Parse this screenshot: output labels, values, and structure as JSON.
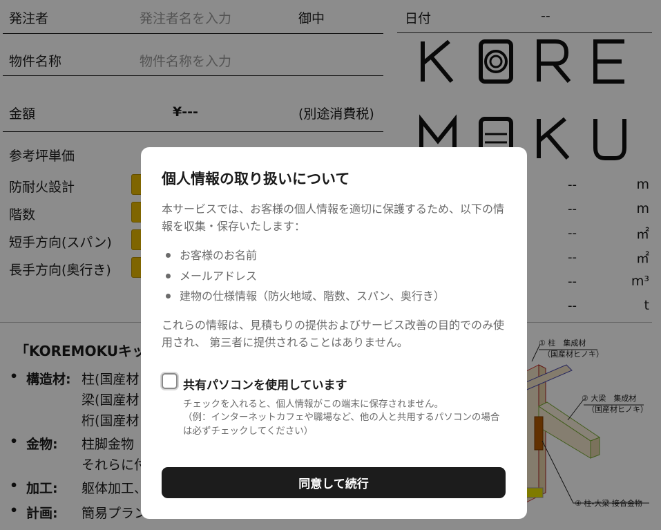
{
  "form": {
    "orderer_label": "発注者",
    "orderer_placeholder": "発注者名を入力",
    "orderer_suffix": "御中",
    "property_label": "物件名称",
    "property_placeholder": "物件名称を入力",
    "amount_label": "金額",
    "amount_value": "¥---",
    "amount_note": "(別途消費税)",
    "reference_label": "参考坪単価",
    "fireproof_label": "防耐火設計",
    "floors_label": "階数",
    "short_span_label": "短手方向(スパン)",
    "long_span_label": "長手方向(奥行き)"
  },
  "date": {
    "label": "日付",
    "value": "--"
  },
  "logo": {
    "line1": "KOREMOKU"
  },
  "specs": [
    {
      "value": "--",
      "unit": "m"
    },
    {
      "value": "--",
      "unit": "m"
    },
    {
      "value": "--",
      "unit": "㎡"
    },
    {
      "value": "--",
      "unit": "㎡"
    },
    {
      "value": "--",
      "unit": "m³"
    },
    {
      "value": "--",
      "unit": "t"
    }
  ],
  "kit": {
    "title": "「KOREMOKUキッ",
    "items": [
      {
        "key": "構造材:",
        "lines": [
          "柱(国産材",
          "梁(国産材",
          "桁(国産材"
        ]
      },
      {
        "key": "金物:",
        "lines": [
          "柱脚金物",
          "それらに付"
        ]
      },
      {
        "key": "加工:",
        "lines": [
          "躯体加工、"
        ]
      },
      {
        "key": "計画:",
        "lines": [
          "簡易プラン"
        ]
      }
    ]
  },
  "diagram": {
    "label1": "① 柱　集成材",
    "label1_sub": "（国産材ヒノキ）",
    "label2": "② 大梁　集成材",
    "label2_sub": "（国産材ヒノキ）",
    "label4": "④ 柱-大梁 接合金物"
  },
  "modal": {
    "title": "個人情報の取り扱いについて",
    "intro": "本サービスでは、お客様の個人情報を適切に保護するため、以下の情報を収集・保存いたします：",
    "items": [
      "お客様のお名前",
      "メールアドレス",
      "建物の仕様情報（防火地域、階数、スパン、奥行き）"
    ],
    "note": "これらの情報は、見積もりの提供およびサービス改善の目的でのみ使用され、 第三者に提供されることはありません。",
    "checkbox_label": "共有パソコンを使用しています",
    "checkbox_help_1": "チェックを入れると、個人情報がこの端末に保存されません。",
    "checkbox_help_2": "（例：インターネットカフェや職場など、他の人と共用するパソコンの場合は必ずチェックしてください）",
    "agree_button": "同意して続行"
  }
}
